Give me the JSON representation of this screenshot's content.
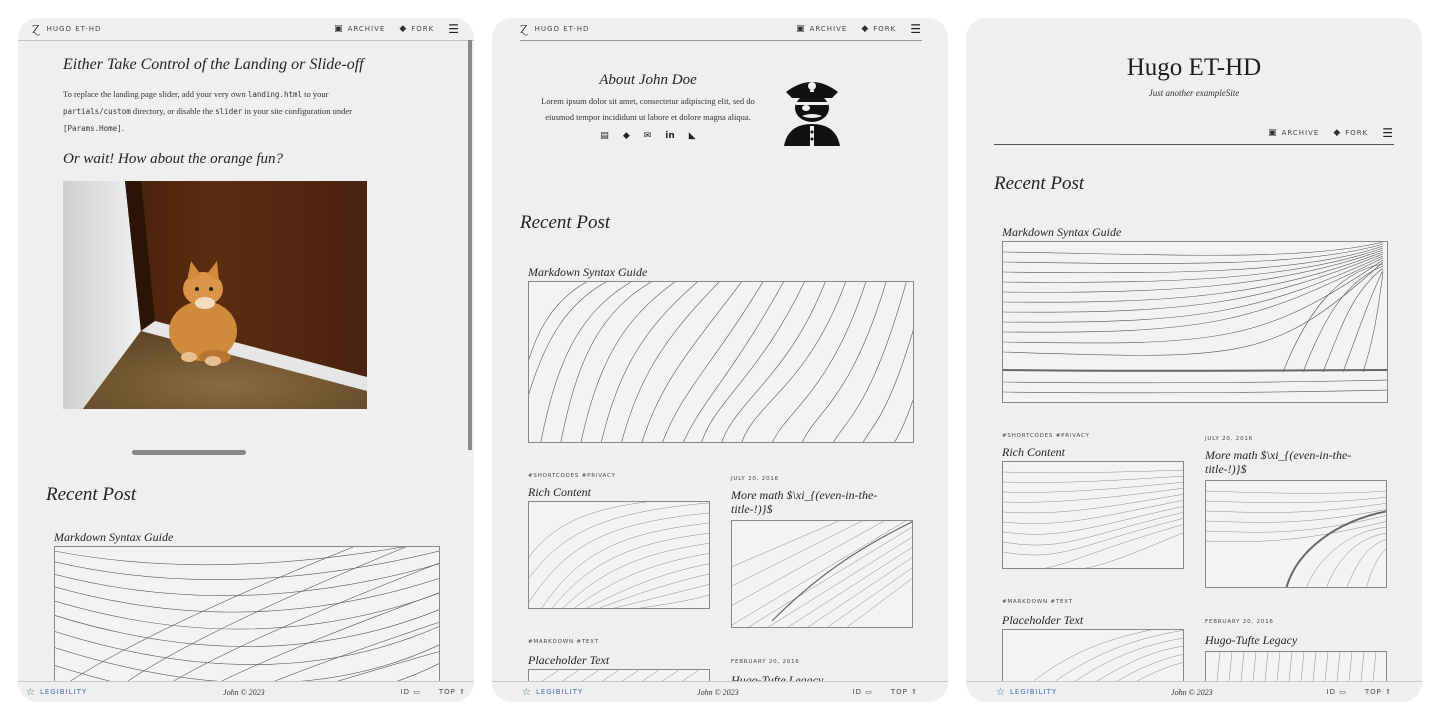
{
  "site": {
    "brand": "HUGO ET-HD",
    "archive_label": "ARCHIVE",
    "fork_label": "FORK",
    "archive_icon": "archive-icon",
    "fork_icon": "git-icon",
    "menu_icon": "hamburger-icon"
  },
  "footer": {
    "legibility_label": "LEGIBILITY",
    "copyright": "John © 2023",
    "id_label": "ID",
    "top_label": "TOP"
  },
  "panel1": {
    "heading": "Either Take Control of the Landing or Slide-off",
    "para_a": "To replace the landing page slider, add your very own ",
    "code_a": "landing.html",
    "para_b": " to your",
    "code_b": "partials/custom",
    "para_c": " directory, or disable the ",
    "code_c": "slider",
    "para_d": " in your site configuration under",
    "code_d": "[Params.Home]",
    "para_e": ".",
    "subheading": "Or wait! How about the orange fun?",
    "section_title": "Recent Post",
    "post_title": "Markdown Syntax Guide"
  },
  "panel2": {
    "about_title": "About John Doe",
    "about_text": "Lorem ipsum dolor sit amet, consectetur adipiscing elit, sed do eiusmod tempor incididunt ut labore et dolore magna aliqua.",
    "section_title": "Recent Post",
    "post_main": "Markdown Syntax Guide",
    "post_a_tags": "#SHORTCODES #PRIVACY",
    "post_a_title": "Rich Content",
    "post_b_date": "JULY 20, 2016",
    "post_b_title": "More math $\\xi_{(even-in-the-title-!)}$",
    "post_c_tags": "#MARKDOWN #TEXT",
    "post_c_title": "Placeholder Text",
    "post_d_date": "FEBRUARY 20, 2016",
    "post_d_title": "Hugo-Tufte Legacy"
  },
  "panel3": {
    "site_title": "Hugo ET-HD",
    "tagline": "Just another exampleSite",
    "section_title": "Recent Post",
    "post_main": "Markdown Syntax Guide",
    "post_a_tags": "#SHORTCODES #PRIVACY",
    "post_a_title": "Rich Content",
    "post_b_date": "JULY 20, 2016",
    "post_b_title": "More math $\\xi_{(even-in-the-title-!)}$",
    "post_c_tags": "#MARKDOWN #TEXT",
    "post_c_title": "Placeholder Text",
    "post_d_date": "FEBRUARY 20, 2016",
    "post_d_title": "Hugo-Tufte Legacy"
  }
}
